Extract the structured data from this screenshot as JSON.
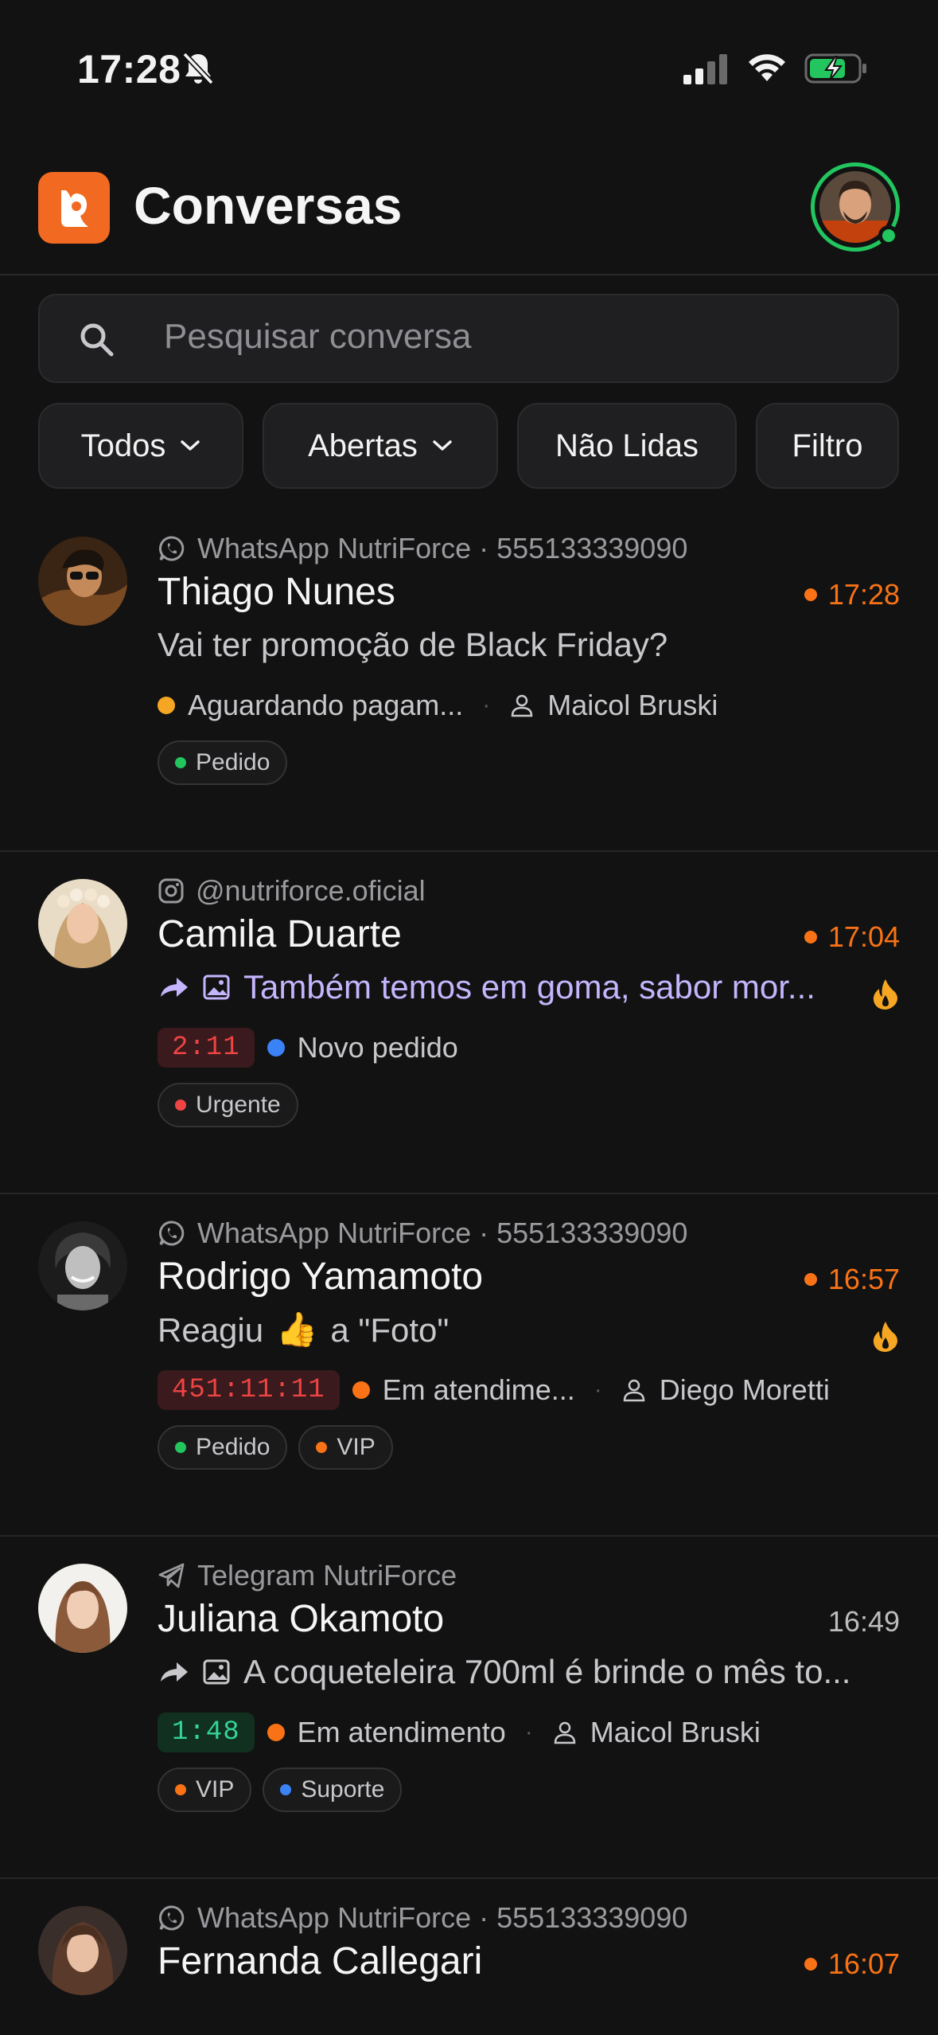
{
  "status_bar": {
    "time": "17:28"
  },
  "header": {
    "title": "Conversas"
  },
  "search": {
    "placeholder": "Pesquisar conversa"
  },
  "filters": [
    {
      "label": "Todos",
      "dropdown": true
    },
    {
      "label": "Abertas",
      "dropdown": true
    },
    {
      "label": "Não Lidas",
      "dropdown": false
    },
    {
      "label": "Filtro",
      "dropdown": false
    }
  ],
  "colors": {
    "accent": "#f26a21",
    "unread_time": "#f97316",
    "online": "#22c55e",
    "status_yellow": "#f5a623",
    "status_blue": "#3b82f6",
    "status_orange": "#f97316",
    "tag_green": "#22c55e",
    "tag_red": "#ef4444",
    "tag_orange": "#f97316",
    "tag_blue": "#3b82f6"
  },
  "conversations": [
    {
      "channel_icon": "whatsapp-icon",
      "channel": "WhatsApp NutriForce · 555133339090",
      "name": "Thiago Nunes",
      "time": "17:28",
      "unread": true,
      "preview": "Vai ter promoção de Black Friday?",
      "status": "Aguardando pagam...",
      "agent": "Maicol Bruski",
      "tags": [
        "Pedido"
      ]
    },
    {
      "channel_icon": "instagram-icon",
      "channel": "@nutriforce.oficial",
      "name": "Camila Duarte",
      "time": "17:04",
      "unread": true,
      "preview": "Também temos em goma, sabor mor...",
      "timer": "2:11",
      "status": "Novo pedido",
      "tags": [
        "Urgente"
      ]
    },
    {
      "channel_icon": "whatsapp-icon",
      "channel": "WhatsApp NutriForce · 555133339090",
      "name": "Rodrigo Yamamoto",
      "time": "16:57",
      "unread": true,
      "preview_a": "Reagiu",
      "preview_emoji": "👍",
      "preview_b": "a \"Foto\"",
      "timer": "451:11:11",
      "status": "Em atendime...",
      "agent": "Diego Moretti",
      "tags": [
        "Pedido",
        "VIP"
      ]
    },
    {
      "channel_icon": "telegram-icon",
      "channel": "Telegram NutriForce",
      "name": "Juliana Okamoto",
      "time": "16:49",
      "unread": false,
      "preview": "A coqueteleira 700ml é brinde o mês to...",
      "timer": "1:48",
      "status": "Em atendimento",
      "agent": "Maicol Bruski",
      "tags": [
        "VIP",
        "Suporte"
      ]
    },
    {
      "channel_icon": "whatsapp-icon",
      "channel": "WhatsApp NutriForce · 555133339090",
      "name": "Fernanda Callegari",
      "time": "16:07",
      "unread": true
    }
  ]
}
